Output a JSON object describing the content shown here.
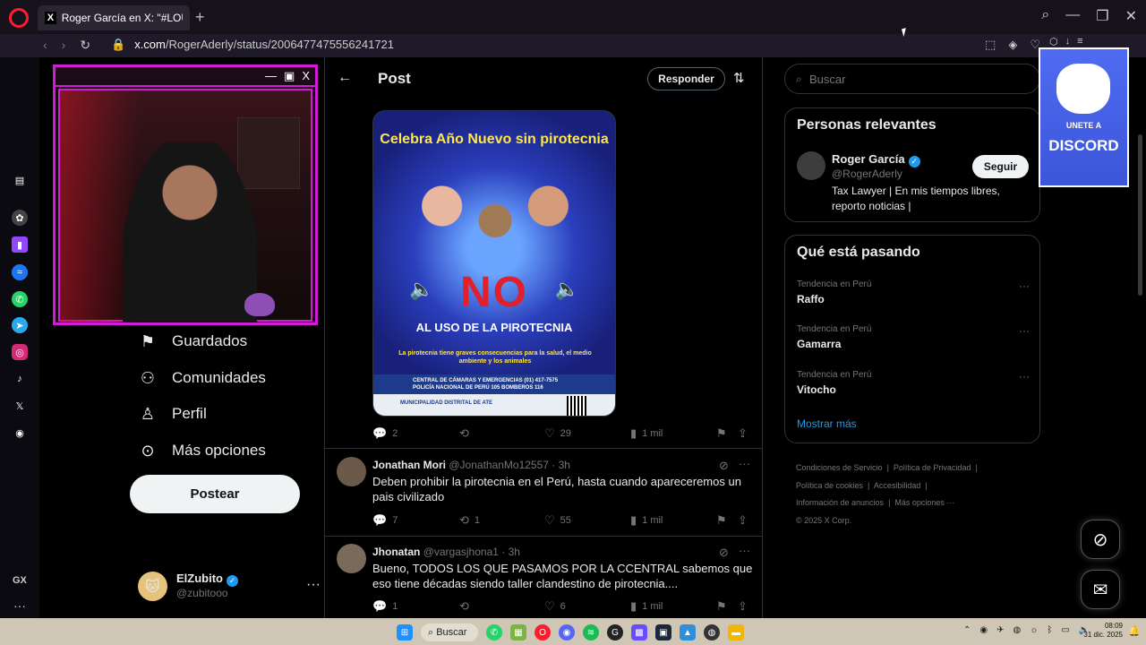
{
  "browser": {
    "tab_title": "Roger García en X: \"#LOÚL",
    "tab_new": "+",
    "url_host": "x.com",
    "url_path": "/RogerAderly/status/2006477475556241721"
  },
  "opera_sidebar": {
    "items": [
      "history-icon",
      "chatgpt-icon",
      "twitch-icon",
      "messenger-icon",
      "whatsapp-icon",
      "telegram-icon",
      "instagram-icon",
      "tiktok-icon",
      "x-icon",
      "discord-icon"
    ],
    "gx_label": "GX",
    "more": "···"
  },
  "left_nav": {
    "items": [
      {
        "label": "Guardados",
        "icon": "bookmark-icon"
      },
      {
        "label": "Comunidades",
        "icon": "communities-icon"
      },
      {
        "label": "Perfil",
        "icon": "profile-icon"
      },
      {
        "label": "Más opciones",
        "icon": "more-options-icon"
      }
    ],
    "post_button": "Postear",
    "account": {
      "name": "ElZubito",
      "handle": "@zubitooo",
      "more": "···"
    }
  },
  "webcam": {
    "controls": [
      "—",
      "▣",
      "X"
    ]
  },
  "main": {
    "header": {
      "title": "Post",
      "reply_button": "Responder"
    },
    "poster": {
      "headline": "Celebra Año Nuevo sin pirotecnia",
      "no": "NO",
      "subhead": "AL USO DE LA PIROTECNIA",
      "small": "La pirotecnia tiene graves consecuencias para la salud, el medio ambiente y los animales",
      "footer_line1": "CENTRAL DE CÁMARAS Y EMERGENCIAS (01) 417-7575",
      "footer_line2": "POLICÍA NACIONAL DE PERÚ 105   BOMBEROS 116",
      "footer_muni": "MUNICIPALIDAD DISTRITAL DE ATE"
    },
    "post_stats": {
      "replies": "2",
      "reposts": "",
      "likes": "29",
      "views": "1 mil"
    },
    "replies": [
      {
        "name": "Jonathan Mori",
        "handle": "@JonathanMo12557 · 3h",
        "text": "Deben prohibir la pirotecnia en el Perú, hasta cuando apareceremos un pais civilizado",
        "stats": {
          "replies": "7",
          "reposts": "1",
          "likes": "55",
          "views": "1 mil"
        }
      },
      {
        "name": "Jhonatan",
        "handle": "@vargasjhona1 · 3h",
        "text": "Bueno, TODOS LOS QUE PASAMOS POR LA CCENTRAL sabemos que eso tiene décadas siendo taller clandestino de pirotecnia....",
        "stats": {
          "replies": "1",
          "reposts": "",
          "likes": "6",
          "views": "1 mil"
        }
      }
    ]
  },
  "right": {
    "search_placeholder": "Buscar",
    "relevant": {
      "title": "Personas relevantes",
      "name": "Roger García",
      "handle": "@RogerAderly",
      "follow": "Seguir",
      "bio": "Tax Lawyer | En mis tiempos libres, reporto noticias |"
    },
    "trends": {
      "title": "Qué está pasando",
      "items": [
        {
          "context": "Tendencia en Perú",
          "topic": "Raffo"
        },
        {
          "context": "Tendencia en Perú",
          "topic": "Gamarra"
        },
        {
          "context": "Tendencia en Perú",
          "topic": "Vitocho"
        }
      ],
      "show_more": "Mostrar más"
    },
    "footer": {
      "links": [
        "Condiciones de Servicio",
        "Política de Privacidad",
        "Política de cookies",
        "Accesibilidad",
        "Información de anuncios",
        "Más opciones ···"
      ],
      "copyright": "© 2025 X Corp."
    }
  },
  "discord_banner": {
    "line1": "UNETE A",
    "line2": "DISCORD"
  },
  "taskbar": {
    "search": "Buscar",
    "time": "08:09",
    "date": "31 dic. 2025"
  },
  "colors": {
    "accent": "#1d9bf0",
    "webcam_border": "#d21bd6",
    "opera_red": "#ff1b2d"
  }
}
